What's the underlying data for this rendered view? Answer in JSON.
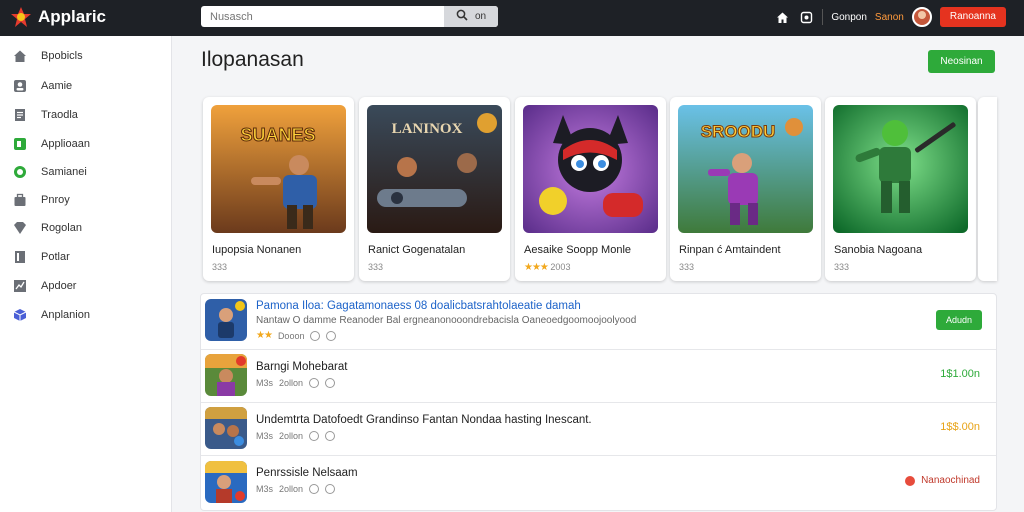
{
  "header": {
    "app_name": "Applaric",
    "search_placeholder": "Nusasch",
    "search_button": "on",
    "links": [
      "Gonpon",
      "Sanon"
    ],
    "cta": "Ranoanna"
  },
  "sidebar": {
    "items": [
      {
        "label": "Bpobicls",
        "icon": "home-icon"
      },
      {
        "label": "Aamie",
        "icon": "person-icon"
      },
      {
        "label": "Traodla",
        "icon": "document-icon"
      },
      {
        "label": "Applioaan",
        "icon": "apps-icon"
      },
      {
        "label": "Samianei",
        "icon": "circle-check-icon"
      },
      {
        "label": "Pnroy",
        "icon": "bag-icon"
      },
      {
        "label": "Rogolan",
        "icon": "diamond-icon"
      },
      {
        "label": "Potlar",
        "icon": "file-icon"
      },
      {
        "label": "Apdoer",
        "icon": "chart-icon"
      },
      {
        "label": "Anplanion",
        "icon": "cube-icon"
      }
    ]
  },
  "main": {
    "title": "Ilopanasan",
    "action_button": "Neosinan",
    "featured": [
      {
        "title": "Iupopsia Nonanen",
        "meta": "333",
        "art_text": "SUANES"
      },
      {
        "title": "Ranict Gogenatalan",
        "meta": "333",
        "art_text": "LANINOX"
      },
      {
        "title": "Aesaike Soopp Monle",
        "meta": "2003",
        "art_text": ""
      },
      {
        "title": "Rinpan ć Amtaindent",
        "meta": "333",
        "art_text": "SROODU"
      },
      {
        "title": "Sanobia Nagoana",
        "meta": "333",
        "art_text": ""
      }
    ],
    "list": [
      {
        "title": "Pamona Iloa: Gagatamonaess 08 doalicbatsrahtolaeatie damah",
        "subtitle": "Nantaw O damme Reanoder Bal ergneanonooondrebacisla Oaneoedgoomoojoolyood",
        "meta": "Dooon",
        "action": "Adudn",
        "kind": "button"
      },
      {
        "title": "Barngi Mohebarat",
        "meta_prefix": "M3s",
        "meta": "2ollon",
        "action": "1$1.00n",
        "kind": "price",
        "price_color": "#2eaa3a"
      },
      {
        "title": "Undemtrta Datofoedt Grandinso Fantan Nondaa hasting Inescant.",
        "meta_prefix": "M3s",
        "meta": "2ollon",
        "action": "1$$.00n",
        "kind": "price",
        "price_color": "#e8a317"
      },
      {
        "title": "Penrssisle Nelsaam",
        "meta_prefix": "M3s",
        "meta": "2ollon",
        "action": "Nanaochinad",
        "kind": "status"
      }
    ]
  },
  "colors": {
    "topbar": "#1e2126",
    "accent_green": "#2eaa3a",
    "cta_red": "#e5331f",
    "link_blue": "#1d63c9"
  }
}
